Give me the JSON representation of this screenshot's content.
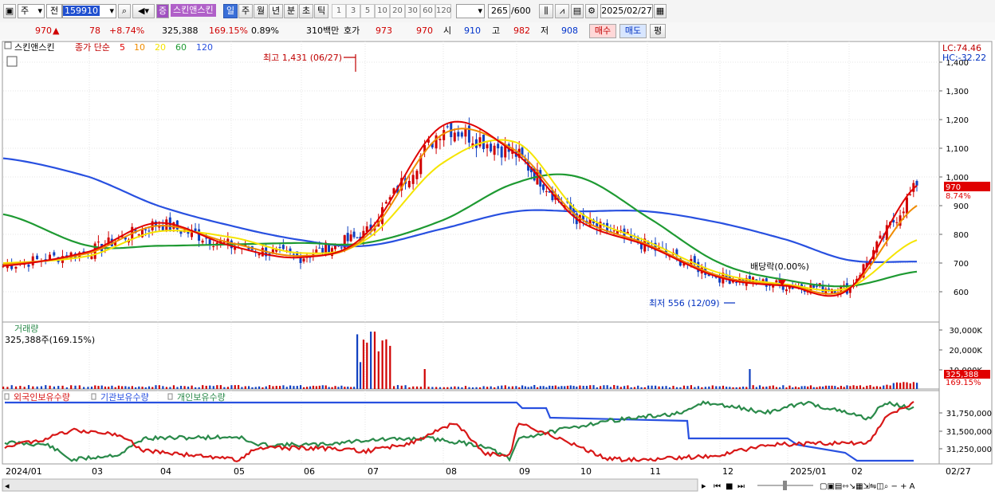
{
  "toolbar": {
    "market_label": "주",
    "prev_label": "전",
    "code": "159910",
    "stock_badge": "증",
    "stock_name": "스킨앤스킨",
    "period_tabs": [
      "일",
      "주",
      "월",
      "년",
      "분",
      "초",
      "틱"
    ],
    "active_period": "일",
    "intervals": [
      "1",
      "3",
      "5",
      "10",
      "20",
      "30",
      "60",
      "120"
    ],
    "count_value": "265",
    "count_max": "/600",
    "date": "2025/02/27"
  },
  "quote": {
    "price": "970",
    "arrow": "▲",
    "change": "78",
    "change_pct": "+8.74%",
    "volume": "325,388",
    "volume_ratio": "169.15%",
    "turnover": "0.89%",
    "amount": "310백만",
    "hoga_label": "호가",
    "ask": "973",
    "bid": "970",
    "open_label": "시",
    "open": "910",
    "high_label": "고",
    "high": "982",
    "low_label": "저",
    "low": "908",
    "buy_label": "매수",
    "sell_label": "매도",
    "avg_label": "평"
  },
  "colors": {
    "up": "#d00000",
    "down": "#1040c0",
    "ma5": "#e00000",
    "ma10": "#f08c00",
    "ma20": "#f5e400",
    "ma60": "#1e9a32",
    "ma120": "#2850e0",
    "foreign": "#d81818",
    "institution": "#2850e0",
    "individual": "#2a8a4a"
  },
  "price_panel": {
    "name_tag": "스킨앤스킨",
    "ma_title": "종가 단순",
    "ma_periods": [
      "5",
      "10",
      "20",
      "60",
      "120"
    ],
    "lc": "LC:74.46",
    "hc": "HC:-32.22",
    "high_annotation": "최고 1,431 (06/27)",
    "low_annotation": "최저 556 (12/09)",
    "dividend_annotation": "배당락(0.00%)",
    "last_price_tag": "970",
    "last_pct_tag": "8.74%"
  },
  "volume_panel": {
    "title": "거래량",
    "current": "325,388주(169.15%)",
    "ticks": [
      "30,000K",
      "20,000K",
      "10,000K"
    ],
    "last_tag": "325,388",
    "last_pct_tag": "169.15%"
  },
  "holding_panel": {
    "labels": [
      "외국인보유수량",
      "기관보유수량",
      "개인보유수량"
    ],
    "ticks": [
      "31,750,000",
      "31,500,000",
      "31,250,000"
    ]
  },
  "x_axis": {
    "labels": [
      "2024/01",
      "03",
      "04",
      "05",
      "06",
      "07",
      "08",
      "09",
      "10",
      "11",
      "12",
      "2025/01",
      "02"
    ],
    "end_label": "02/27"
  },
  "chart_data": {
    "type": "line",
    "x": [
      "2024-01",
      "2024-02",
      "2024-03",
      "2024-04",
      "2024-05",
      "2024-06",
      "2024-07",
      "2024-08",
      "2024-09",
      "2024-10",
      "2024-11",
      "2024-12",
      "2025-01",
      "2025-02-27"
    ],
    "y_ticks": [
      "600",
      "700",
      "800",
      "900",
      "1,000",
      "1,100",
      "1,200",
      "1,300",
      "1,400"
    ],
    "ylim": [
      550,
      1450
    ],
    "series": [
      {
        "name": "5",
        "values": [
          690,
          740,
          840,
          760,
          720,
          800,
          1180,
          1080,
          850,
          760,
          650,
          620,
          610,
          970
        ]
      },
      {
        "name": "10",
        "values": [
          695,
          735,
          830,
          770,
          725,
          790,
          1150,
          1090,
          860,
          765,
          655,
          622,
          612,
          900
        ]
      },
      {
        "name": "20",
        "values": [
          700,
          725,
          810,
          790,
          735,
          780,
          1050,
          1120,
          880,
          775,
          665,
          625,
          615,
          780
        ]
      },
      {
        "name": "60",
        "values": [
          870,
          760,
          760,
          765,
          770,
          770,
          850,
          980,
          1000,
          860,
          700,
          640,
          620,
          670
        ]
      },
      {
        "name": "120",
        "values": [
          1065,
          1000,
          900,
          830,
          780,
          760,
          820,
          880,
          880,
          880,
          840,
          780,
          710,
          705
        ]
      }
    ],
    "annotations": {
      "high": 1431,
      "high_date": "06/27",
      "low": 556,
      "low_date": "12/09",
      "last": 970,
      "change_pct": 8.74
    }
  }
}
